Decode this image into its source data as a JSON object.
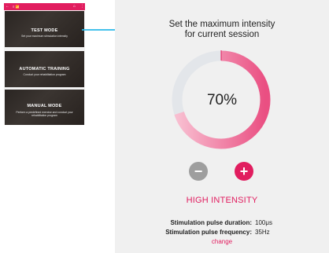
{
  "thumbnail": {
    "toolbar": {
      "back_icon": "back-arrow-icon",
      "logo": "≡ 📶",
      "home_icon": "home-icon",
      "menu_icon": "more-vert-icon"
    },
    "cards": [
      {
        "title": "TEST MODE",
        "subtitle": "Set your maximum stimulation intensity"
      },
      {
        "title": "AUTOMATIC TRAINING",
        "subtitle": "Conduct your rehabilitation program"
      },
      {
        "title": "MANUAL MODE",
        "subtitle": "Perform a predefined exercise and conduct your rehabilitation program"
      }
    ]
  },
  "panel": {
    "heading_line1": "Set the maximum intensity",
    "heading_line2": "for current session",
    "intensity_percent": 70,
    "intensity_label": "70%",
    "minus_icon": "minus-icon",
    "plus_icon": "plus-icon",
    "level": "HIGH INTENSITY",
    "params": [
      {
        "label": "Stimulation pulse duration:",
        "value": "100μs"
      },
      {
        "label": "Stimulation pulse frequency:",
        "value": "35Hz"
      }
    ],
    "change_link": "change"
  },
  "colors": {
    "accent": "#e11d5f",
    "gauge_light": "#f7b6cb",
    "gauge_track": "#e3e6ea",
    "arrow": "#29b8e8",
    "button_disabled": "#9e9e9e"
  }
}
